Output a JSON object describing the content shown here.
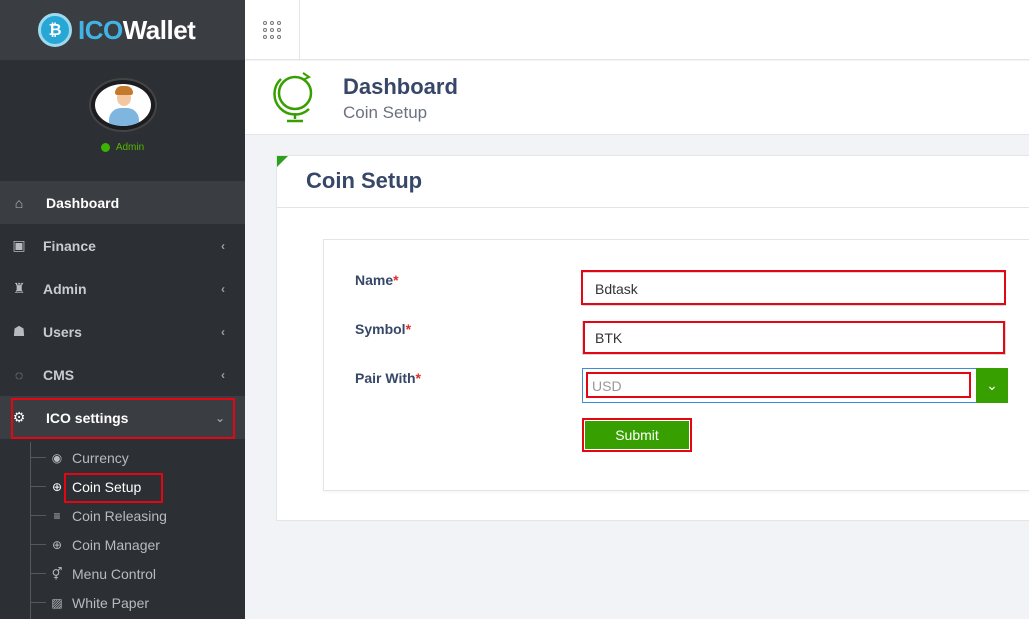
{
  "brand": {
    "logo_glyph": "₿",
    "prefix": "ICO",
    "suffix": "Wallet"
  },
  "user": {
    "role": "Admin",
    "status_color": "#3bb300"
  },
  "sidebar": {
    "items": [
      {
        "label": "Dashboard",
        "icon": "home-icon"
      },
      {
        "label": "Finance",
        "icon": "money-icon"
      },
      {
        "label": "Admin",
        "icon": "user-secret-icon"
      },
      {
        "label": "Users",
        "icon": "users-icon"
      },
      {
        "label": "CMS",
        "icon": "comments-icon"
      },
      {
        "label": "ICO settings",
        "icon": "gear-icon"
      }
    ],
    "submenu": [
      {
        "label": "Currency",
        "icon": "coin-icon"
      },
      {
        "label": "Coin Setup",
        "icon": "life-ring-icon"
      },
      {
        "label": "Coin Releasing",
        "icon": "database-icon"
      },
      {
        "label": "Coin Manager",
        "icon": "life-ring-icon"
      },
      {
        "label": "Menu Control",
        "icon": "venus-mars-icon"
      },
      {
        "label": "White Paper",
        "icon": "image-icon"
      }
    ]
  },
  "page_header": {
    "title": "Dashboard",
    "subtitle": "Coin Setup"
  },
  "card": {
    "title": "Coin Setup"
  },
  "form": {
    "name": {
      "label": "Name",
      "value": "Bdtask"
    },
    "symbol": {
      "label": "Symbol",
      "value": "BTK"
    },
    "pair": {
      "label": "Pair With",
      "value": "USD"
    },
    "required_mark": "*",
    "submit_label": "Submit"
  },
  "colors": {
    "accent": "#37a000",
    "highlight": "#e30613",
    "sidebar_bg": "#2c2f33"
  }
}
